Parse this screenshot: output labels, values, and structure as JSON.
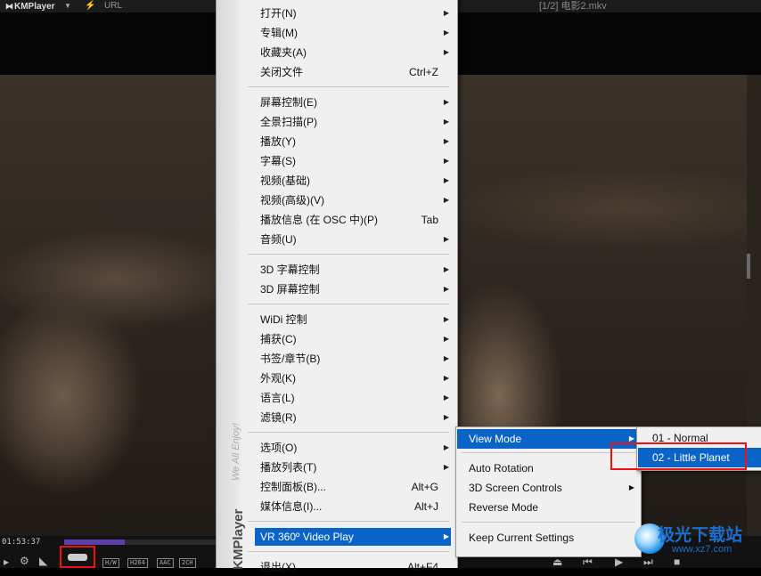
{
  "title_bar": {
    "app_name": "KMPlayer",
    "url_label": "URL",
    "file_title": "[1/2] 电影2.mkv"
  },
  "player": {
    "elapsed": "01:53:37",
    "progress": 0.13,
    "codec_badges": [
      "H/W",
      "H264",
      "AAC",
      "2CH"
    ]
  },
  "menu": {
    "brand": "KMPlayer",
    "tagline": "We All Enjoy!",
    "items": [
      {
        "label": "打开(N)",
        "shortcut": "",
        "submenu": true
      },
      {
        "label": "专辑(M)",
        "shortcut": "",
        "submenu": true
      },
      {
        "label": "收藏夹(A)",
        "shortcut": "",
        "submenu": true
      },
      {
        "label": "关闭文件",
        "shortcut": "Ctrl+Z",
        "submenu": false
      },
      {
        "label": "屏幕控制(E)",
        "shortcut": "",
        "submenu": true
      },
      {
        "label": "全景扫描(P)",
        "shortcut": "",
        "submenu": true
      },
      {
        "label": "播放(Y)",
        "shortcut": "",
        "submenu": true
      },
      {
        "label": "字幕(S)",
        "shortcut": "",
        "submenu": true
      },
      {
        "label": "视频(基础)",
        "shortcut": "",
        "submenu": true
      },
      {
        "label": "视频(高级)(V)",
        "shortcut": "",
        "submenu": true
      },
      {
        "label": "播放信息 (在 OSC 中)(P)",
        "shortcut": "Tab",
        "submenu": false
      },
      {
        "label": "音频(U)",
        "shortcut": "",
        "submenu": true
      },
      {
        "label": "3D 字幕控制",
        "shortcut": "",
        "submenu": true
      },
      {
        "label": "3D 屏幕控制",
        "shortcut": "",
        "submenu": true
      },
      {
        "label": "WiDi 控制",
        "shortcut": "",
        "submenu": true
      },
      {
        "label": "捕获(C)",
        "shortcut": "",
        "submenu": true
      },
      {
        "label": "书签/章节(B)",
        "shortcut": "",
        "submenu": true
      },
      {
        "label": "外观(K)",
        "shortcut": "",
        "submenu": true
      },
      {
        "label": "语言(L)",
        "shortcut": "",
        "submenu": true
      },
      {
        "label": "滤镜(R)",
        "shortcut": "",
        "submenu": true
      },
      {
        "label": "选项(O)",
        "shortcut": "",
        "submenu": true
      },
      {
        "label": "播放列表(T)",
        "shortcut": "",
        "submenu": true
      },
      {
        "label": "控制面板(B)...",
        "shortcut": "Alt+G",
        "submenu": false
      },
      {
        "label": "媒体信息(I)...",
        "shortcut": "Alt+J",
        "submenu": false
      },
      {
        "label": "VR 360º Video Play",
        "shortcut": "",
        "submenu": true
      },
      {
        "label": "退出(X)",
        "shortcut": "Alt+F4",
        "submenu": false
      }
    ]
  },
  "vr_submenu": {
    "items": [
      "View Mode",
      "Auto Rotation",
      "3D Screen Controls",
      "Reverse Mode",
      "Keep Current Settings"
    ]
  },
  "view_mode_submenu": {
    "items": [
      "01 - Normal",
      "02 - Little Planet"
    ]
  },
  "watermark": {
    "title": "极光下载站",
    "url": "www.xz7.com"
  },
  "colors": {
    "highlight": "#0a64c8",
    "annotation_red": "#e11111",
    "progress": "#5b3fa6"
  }
}
